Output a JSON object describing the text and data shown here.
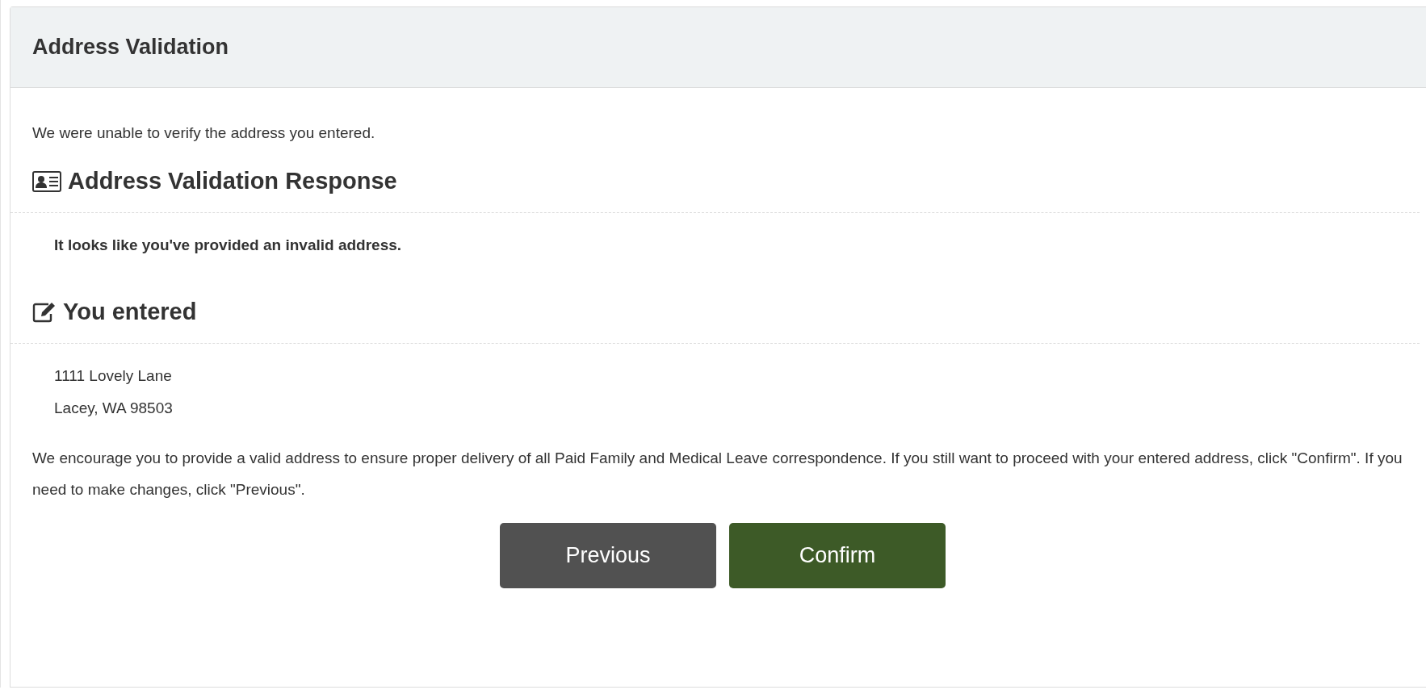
{
  "panel": {
    "title": "Address Validation"
  },
  "intro": "We were unable to verify the address you entered.",
  "sections": [
    {
      "kind": "response",
      "heading": "Address Validation Response",
      "lines": [
        "It looks like you've provided an invalid address."
      ]
    },
    {
      "kind": "entered",
      "heading": "You entered",
      "lines": [
        "1111 Lovely Lane",
        "Lacey, WA 98503"
      ]
    }
  ],
  "message": "We encourage you to provide a valid address to ensure proper delivery of all Paid Family and Medical Leave correspondence. If you still want to proceed with your entered address, click \"Confirm\". If you need to make changes, click \"Previous\".",
  "buttons": [
    {
      "kind": "secondary",
      "label": "Previous"
    },
    {
      "kind": "primary",
      "label": "Confirm"
    }
  ]
}
